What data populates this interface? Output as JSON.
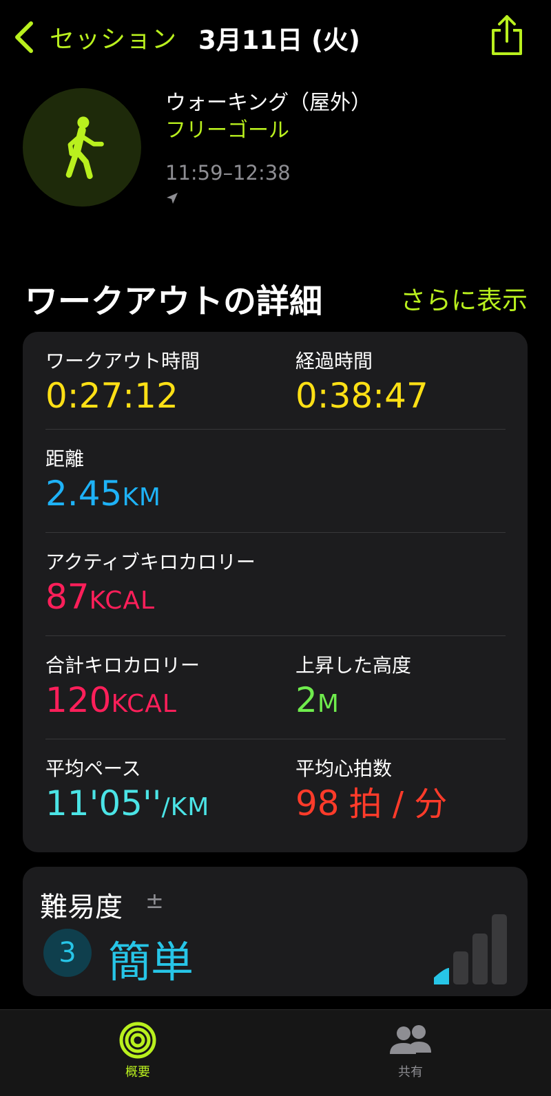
{
  "nav": {
    "back_label": "セッション",
    "title": "3月11日 (火)"
  },
  "workout": {
    "name": "ウォーキング（屋外）",
    "goal": "フリーゴール",
    "time_range": "11:59–12:38"
  },
  "section": {
    "title": "ワークアウトの詳細",
    "more_label": "さらに表示"
  },
  "metrics": {
    "workout_time": {
      "label": "ワークアウト時間",
      "value": "0:27:12",
      "color": "#ffe015"
    },
    "elapsed_time": {
      "label": "経過時間",
      "value": "0:38:47",
      "color": "#ffe015"
    },
    "distance": {
      "label": "距離",
      "value": "2.45",
      "unit": "KM",
      "color": "#1eb2f7"
    },
    "active_kcal": {
      "label": "アクティブキロカロリー",
      "value": "87",
      "unit": "KCAL",
      "color": "#ff1f5a"
    },
    "total_kcal": {
      "label": "合計キロカロリー",
      "value": "120",
      "unit": "KCAL",
      "color": "#ff1f5a"
    },
    "elevation": {
      "label": "上昇した高度",
      "value": "2",
      "unit": "M",
      "color": "#6fec4d"
    },
    "avg_pace": {
      "label": "平均ペース",
      "value": "11'05''",
      "unit": "/KM",
      "color": "#4be4e6"
    },
    "avg_hr": {
      "label": "平均心拍数",
      "value": "98",
      "unit": "拍 / 分",
      "color": "#ff3b2a"
    }
  },
  "effort": {
    "title": "難易度",
    "adjust_symbol": "±",
    "level": "3",
    "label": "簡単",
    "color": "#27c5e7"
  },
  "tabs": [
    {
      "label": "概要",
      "active": true,
      "color": "#b9f01e",
      "icon": "activity-rings-icon"
    },
    {
      "label": "共有",
      "active": false,
      "color": "#8e8e93",
      "icon": "people-icon"
    }
  ]
}
